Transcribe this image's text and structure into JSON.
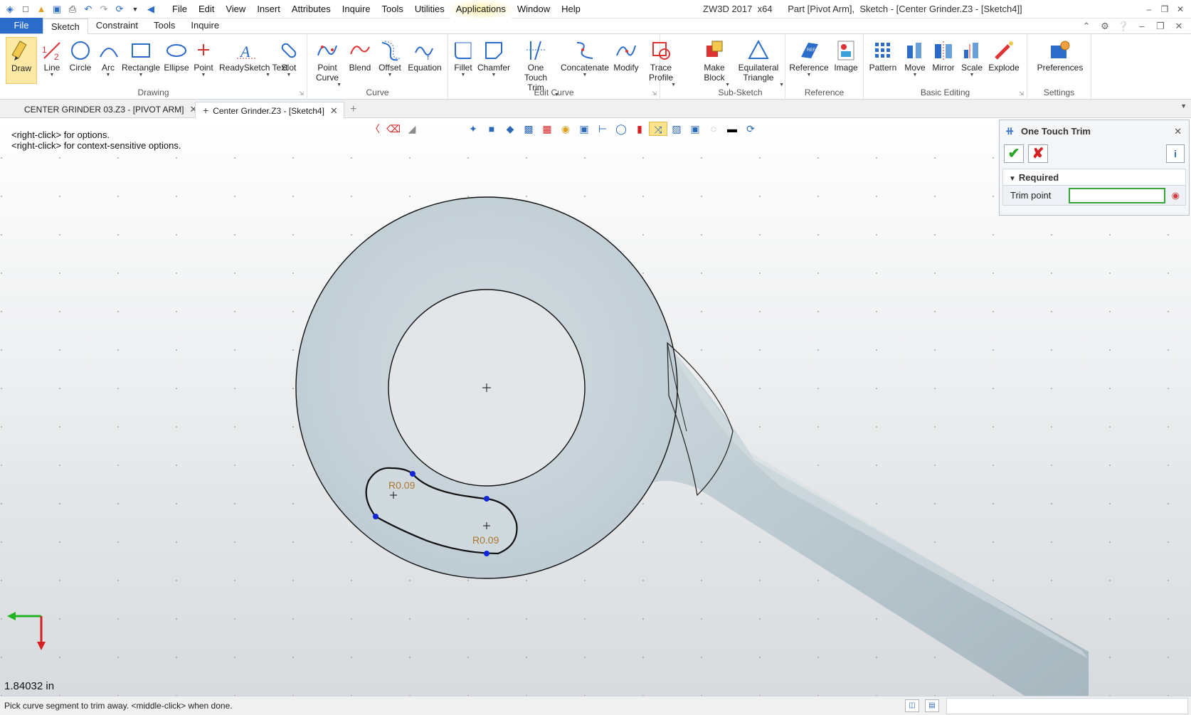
{
  "title_bar": {
    "menu": [
      "File",
      "Edit",
      "View",
      "Insert",
      "Attributes",
      "Inquire",
      "Tools",
      "Utilities",
      "Applications",
      "Window",
      "Help"
    ],
    "app_version": "ZW3D 2017  x64",
    "doc_title": "Part [Pivot Arm],  Sketch - [Center Grinder.Z3 - [Sketch4]]"
  },
  "ribbon_tabs": {
    "file": "File",
    "tabs": [
      "Sketch",
      "Constraint",
      "Tools",
      "Inquire"
    ],
    "active": "Sketch"
  },
  "ribbon": {
    "drawing": {
      "label": "Drawing",
      "buttons": [
        "Draw",
        "Line",
        "Circle",
        "Arc",
        "Rectangle",
        "Ellipse",
        "Point",
        "ReadySketch Text",
        "Slot"
      ]
    },
    "curve": {
      "label": "Curve",
      "buttons": [
        "Point Curve",
        "Blend",
        "Offset",
        "Equation"
      ]
    },
    "edit_curve": {
      "label": "Edit Curve",
      "buttons": [
        "Fillet",
        "Chamfer",
        "One Touch Trim",
        "Concatenate",
        "Modify",
        "Trace Profile"
      ]
    },
    "sub_sketch": {
      "label": "Sub-Sketch",
      "buttons": [
        "Make Block",
        "Equilateral Triangle"
      ]
    },
    "reference": {
      "label": "Reference",
      "buttons": [
        "Reference",
        "Image"
      ]
    },
    "basic_editing": {
      "label": "Basic Editing",
      "buttons": [
        "Pattern",
        "Move",
        "Mirror",
        "Scale",
        "Explode"
      ]
    },
    "settings": {
      "label": "Settings",
      "buttons": [
        "Preferences"
      ]
    }
  },
  "doc_tabs": [
    {
      "label": "CENTER GRINDER 03.Z3 - [PIVOT ARM]",
      "active": false
    },
    {
      "label": "Center Grinder.Z3 - [Sketch4]",
      "active": true
    }
  ],
  "viewport": {
    "hints": [
      "<right-click> for options.",
      "<right-click> for context-sensitive options."
    ],
    "dim_labels": [
      "R0.09",
      "R0.09"
    ],
    "scale_readout": "1.84032 in"
  },
  "panel": {
    "title": "One Touch Trim",
    "section": "Required",
    "field_label": "Trim point",
    "field_value": ""
  },
  "status_bar": {
    "prompt": "Pick curve segment to trim away.  <middle-click> when done."
  },
  "colors": {
    "accent_blue": "#2b6bc9",
    "ok_green": "#2aa42a",
    "cancel_red": "#d42020",
    "dim_text": "#a9762f",
    "part_fill": "#c3d0d6"
  }
}
